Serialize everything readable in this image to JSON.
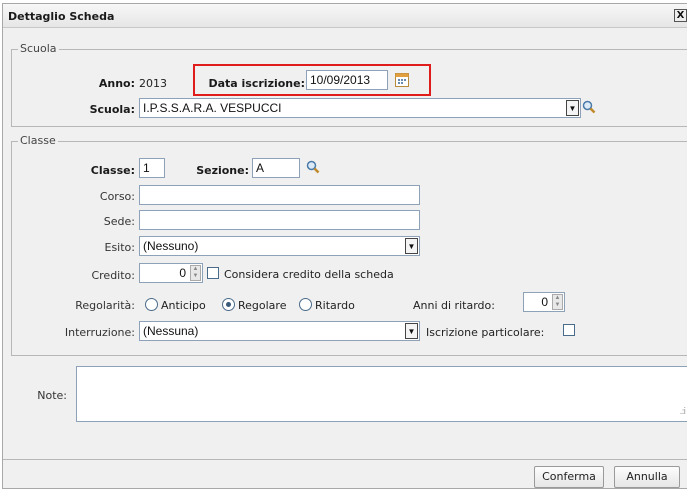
{
  "dialog": {
    "title": "Dettaglio Scheda",
    "close_label": "X"
  },
  "scuola_section": {
    "legend": "Scuola",
    "anno_label": "Anno:",
    "anno_value": "2013",
    "data_iscrizione_label": "Data iscrizione:",
    "data_iscrizione_value": "10/09/2013",
    "scuola_label": "Scuola:",
    "scuola_value": "I.P.S.S.A.R.A. VESPUCCI"
  },
  "classe_section": {
    "legend": "Classe",
    "classe_label": "Classe:",
    "classe_value": "1",
    "sezione_label": "Sezione:",
    "sezione_value": "A",
    "corso_label": "Corso:",
    "corso_value": "",
    "sede_label": "Sede:",
    "sede_value": "",
    "esito_label": "Esito:",
    "esito_value": "(Nessuno)",
    "credito_label": "Credito:",
    "credito_value": "0",
    "considera_label": "Considera credito della scheda",
    "regolarita_label": "Regolarità:",
    "radio_anticipo": "Anticipo",
    "radio_regolare": "Regolare",
    "radio_ritardo": "Ritardo",
    "regolarita_selected": "Regolare",
    "anni_ritardo_label": "Anni di ritardo:",
    "anni_ritardo_value": "0",
    "interruzione_label": "Interruzione:",
    "interruzione_value": "(Nessuna)",
    "iscrizione_particolare_label": "Iscrizione particolare:"
  },
  "notes": {
    "label": "Note:",
    "value": ""
  },
  "footer": {
    "confirm_label": "Conferma",
    "cancel_label": "Annulla"
  },
  "colors": {
    "highlight": "#e01b1b",
    "input_border": "#8da2b8",
    "dialog_bg": "#f0f0f0"
  }
}
